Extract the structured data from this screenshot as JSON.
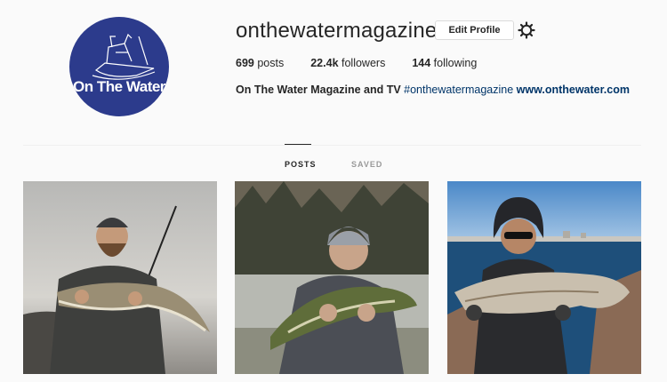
{
  "profile": {
    "avatar_text": "On The Water",
    "username": "onthewatermagazine",
    "edit_profile_label": "Edit Profile",
    "settings_icon": "gear-icon",
    "stats": {
      "posts_count": "699",
      "posts_label": "posts",
      "followers_count": "22.4k",
      "followers_label": "followers",
      "following_count": "144",
      "following_label": "following"
    },
    "bio": {
      "name": "On The Water Magazine and TV",
      "hashtag": "#onthewatermagazine",
      "website": "www.onthewater.com"
    }
  },
  "tabs": [
    {
      "label": "POSTS",
      "active": true
    },
    {
      "label": "SAVED",
      "active": false
    }
  ],
  "colors": {
    "avatar_bg": "#2c3b8c",
    "link": "#003569",
    "background": "#fafafa"
  }
}
